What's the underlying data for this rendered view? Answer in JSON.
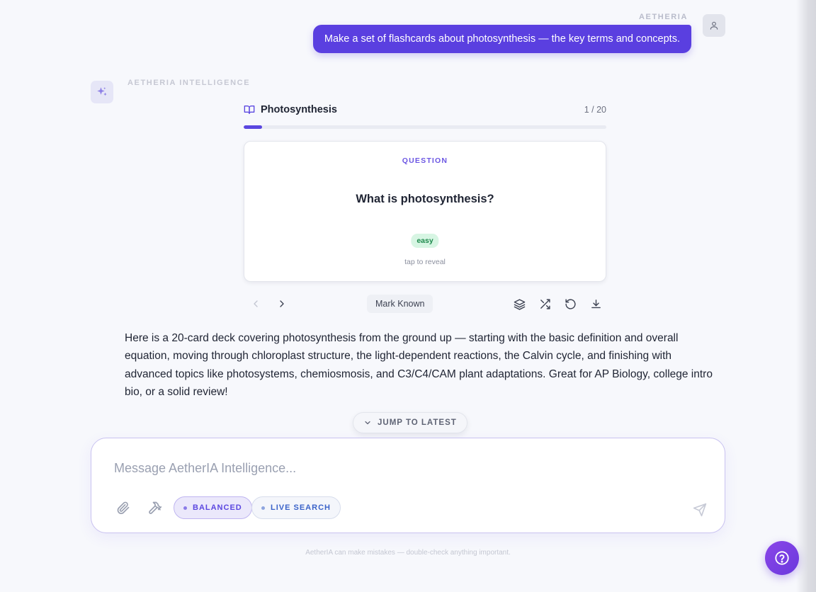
{
  "user_message": {
    "sender": "AETHERIA",
    "text": "Make a set of flashcards about photosynthesis — the key terms and concepts."
  },
  "assistant": {
    "name": "AETHERIA INTELLIGENCE",
    "flashcards": {
      "title": "Photosynthesis",
      "counter": "1 / 20",
      "progress": 0.05,
      "card": {
        "kicker": "QUESTION",
        "question": "What is photosynthesis?",
        "difficulty": "easy",
        "hint": "tap to reveal"
      },
      "mark_known_label": "Mark Known",
      "icons": [
        "chevron-left-icon",
        "chevron-right-icon",
        "layers-icon",
        "shuffle-icon",
        "reset-icon",
        "download-icon"
      ]
    },
    "text": "Here is a 20-card deck covering photosynthesis from the ground up — starting with the basic definition and overall equation, moving through chloroplast structure, the light-dependent reactions, the Calvin cycle, and finishing with advanced topics like photosystems, chemiosmosis, and C3/C4/CAM plant adaptations. Great for AP Biology, college intro bio, or a solid review!"
  },
  "jump_label": "JUMP TO LATEST",
  "composer": {
    "placeholder": "Message AetherIA Intelligence...",
    "value": "",
    "mode_label": "BALANCED",
    "search_label": "LIVE SEARCH"
  },
  "disclaimer": "AetherIA can make mistakes — double-check anything important.",
  "colors": {
    "accent": "#5a3fe0",
    "background": "#f7f8fc",
    "easy_badge": "#d7f5e3"
  }
}
